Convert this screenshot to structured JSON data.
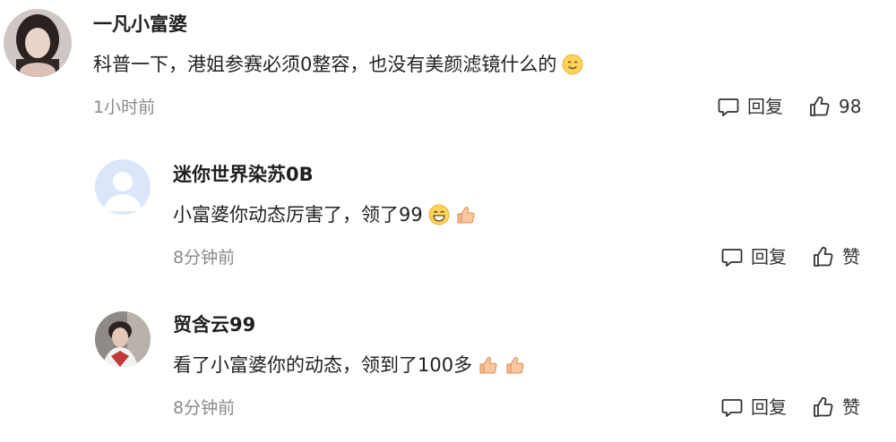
{
  "comments": [
    {
      "username": "一凡小富婆",
      "text": "科普一下，港姐参赛必须0整容，也没有美颜滤镜什么的",
      "emojis": [
        "smile-emoji"
      ],
      "time": "1小时前",
      "reply_label": "回复",
      "like_label": "98"
    },
    {
      "username": "迷你世界染苏0B",
      "text": "小富婆你动态厉害了，领了99",
      "emojis": [
        "grin-emoji",
        "thumbs-up-emoji"
      ],
      "time": "8分钟前",
      "reply_label": "回复",
      "like_label": "赞"
    },
    {
      "username": "贸含云99",
      "text": "看了小富婆你的动态，领到了100多",
      "emojis": [
        "thumbs-up-emoji",
        "thumbs-up-emoji"
      ],
      "time": "8分钟前",
      "reply_label": "回复",
      "like_label": "赞"
    }
  ],
  "colors": {
    "text": "#222222",
    "muted": "#8a8a8a",
    "default_avatar_bg": "#dbe6fb",
    "default_avatar_fg": "#ffffff"
  }
}
